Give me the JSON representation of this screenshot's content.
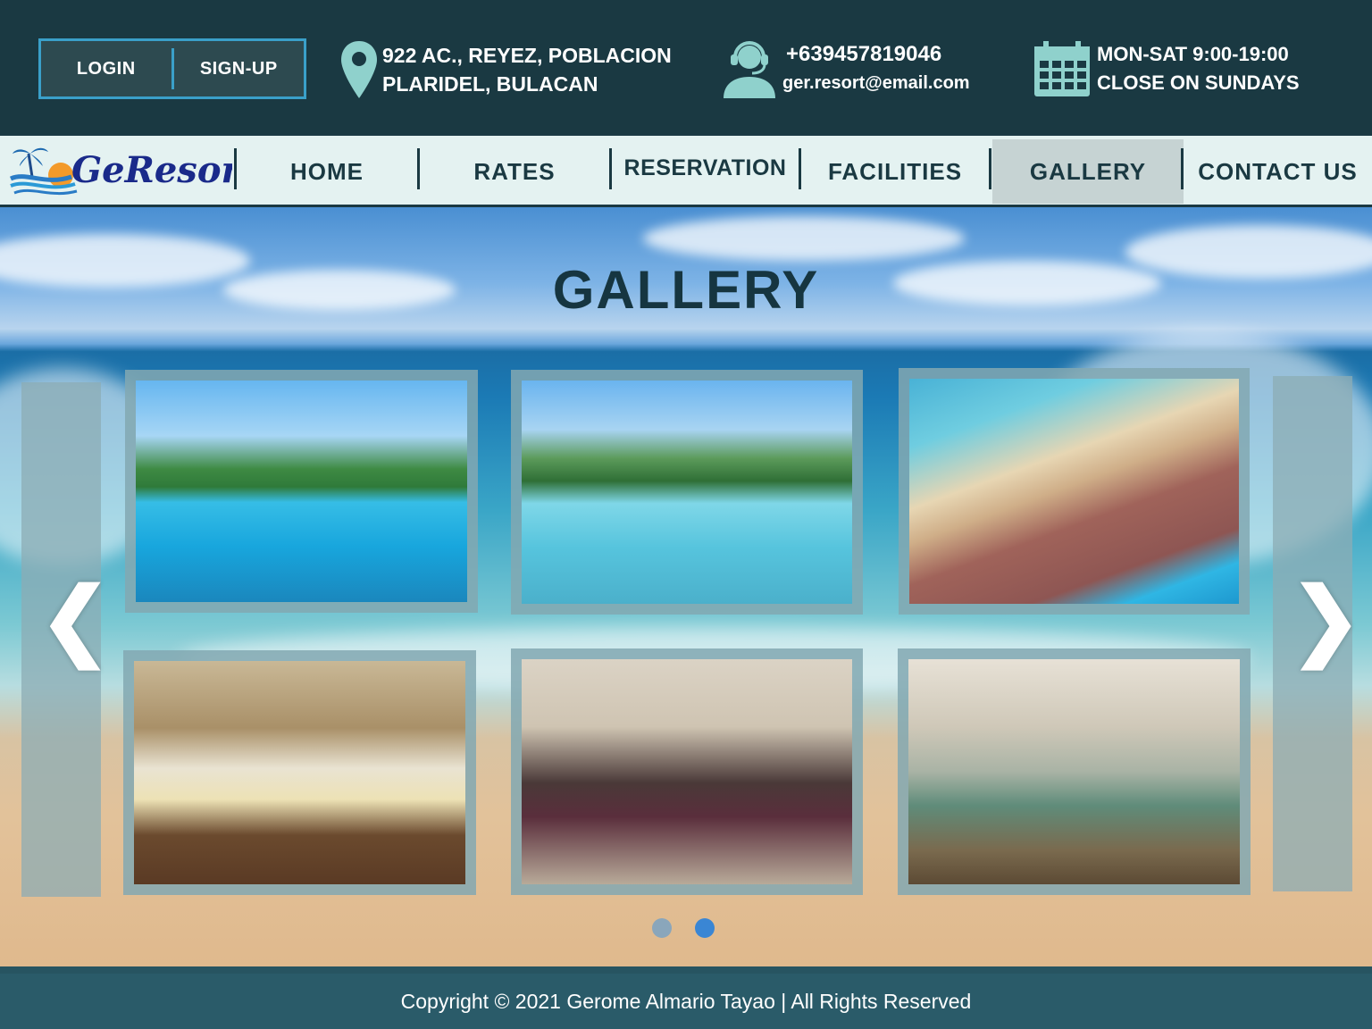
{
  "auth": {
    "login": "LOGIN",
    "signup": "SIGN-UP"
  },
  "contact": {
    "address_line1": "922 AC., REYEZ, POBLACION",
    "address_line2": "PLARIDEL, BULACAN",
    "phone": "+639457819046",
    "email": "ger.resort@email.com",
    "hours_line1": "MON-SAT 9:00-19:00",
    "hours_line2": "CLOSE ON SUNDAYS"
  },
  "brand": {
    "name": "GeResort"
  },
  "nav": {
    "items": [
      {
        "label": "HOME"
      },
      {
        "label": "RATES"
      },
      {
        "label": "RESERVATION"
      },
      {
        "label": "FACILITIES"
      },
      {
        "label": "GALLERY"
      },
      {
        "label": "CONTACT US"
      }
    ],
    "active": "GALLERY"
  },
  "gallery": {
    "title": "GALLERY",
    "prev_arrow": "❮",
    "next_arrow": "❯",
    "active_page": 2,
    "pages": 2,
    "icons": [
      "location-pin-icon",
      "support-headset-icon",
      "calendar-icon",
      "chevron-left-icon",
      "chevron-right-icon"
    ]
  },
  "colors": {
    "topbar": "#1a3942",
    "accent": "#3aa0c9",
    "nav_bg": "#e4f2f1",
    "nav_text": "#1a3942",
    "icon_teal": "#8fd1cc",
    "footer": "#2a5b69",
    "dot_active": "#3a86d4",
    "dot_inactive": "#8aa6bb"
  },
  "footer": {
    "copyright": "Copyright © 2021 Gerome Almario Tayao | All Rights Reserved"
  }
}
